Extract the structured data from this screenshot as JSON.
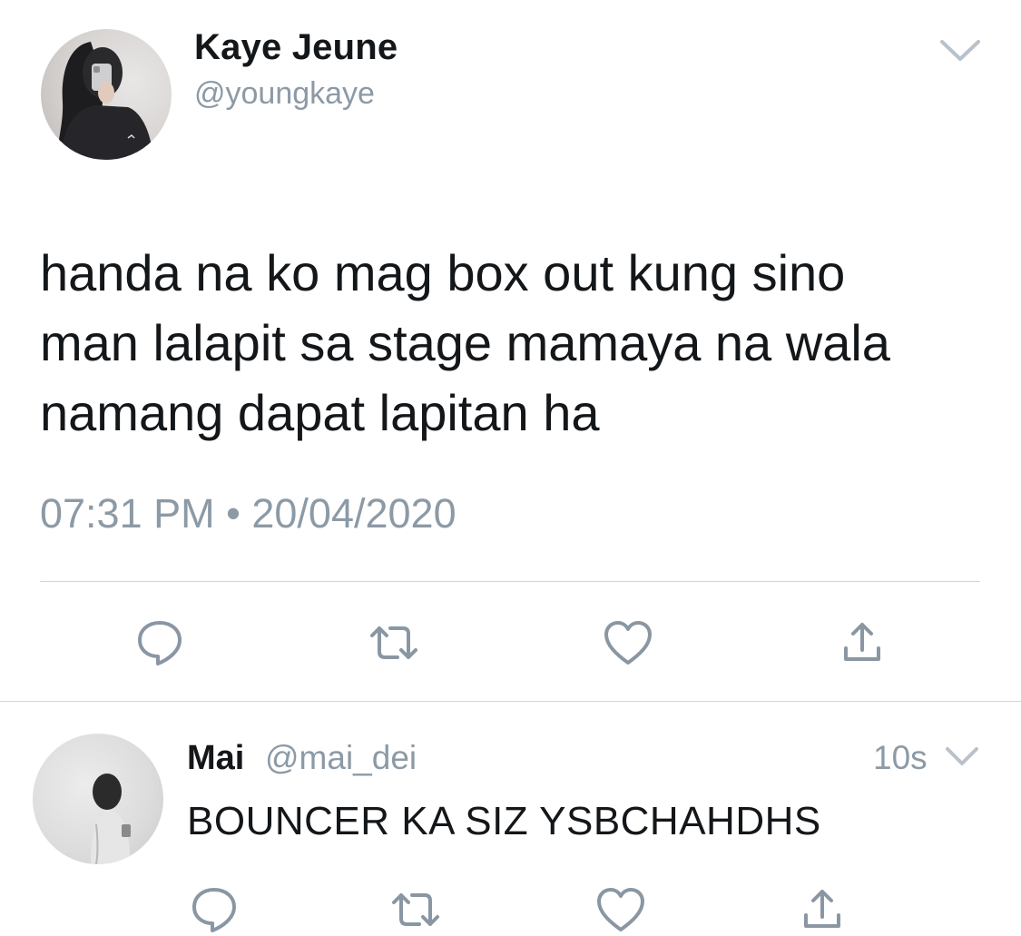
{
  "tweet": {
    "author_name": "Kaye Jeune",
    "author_handle": "@youngkaye",
    "text": "handa na ko mag box out kung sino\nman lalapit sa stage mamaya na wala\nnamang dapat lapitan ha",
    "timestamp": "07:31 PM • 20/04/2020",
    "actions": [
      "reply-icon",
      "retweet-icon",
      "like-icon",
      "share-icon"
    ]
  },
  "reply": {
    "author_name": "Mai",
    "author_handle": "@mai_dei",
    "time_ago": "10s",
    "text": "BOUNCER KA SIZ YSBCHAHDHS",
    "actions": [
      "reply-icon",
      "retweet-icon",
      "like-icon",
      "share-icon"
    ]
  },
  "colors": {
    "text": "#14171a",
    "secondary": "#8c9aa6",
    "icon": "#8a97a3",
    "divider": "#cfd6dc"
  }
}
